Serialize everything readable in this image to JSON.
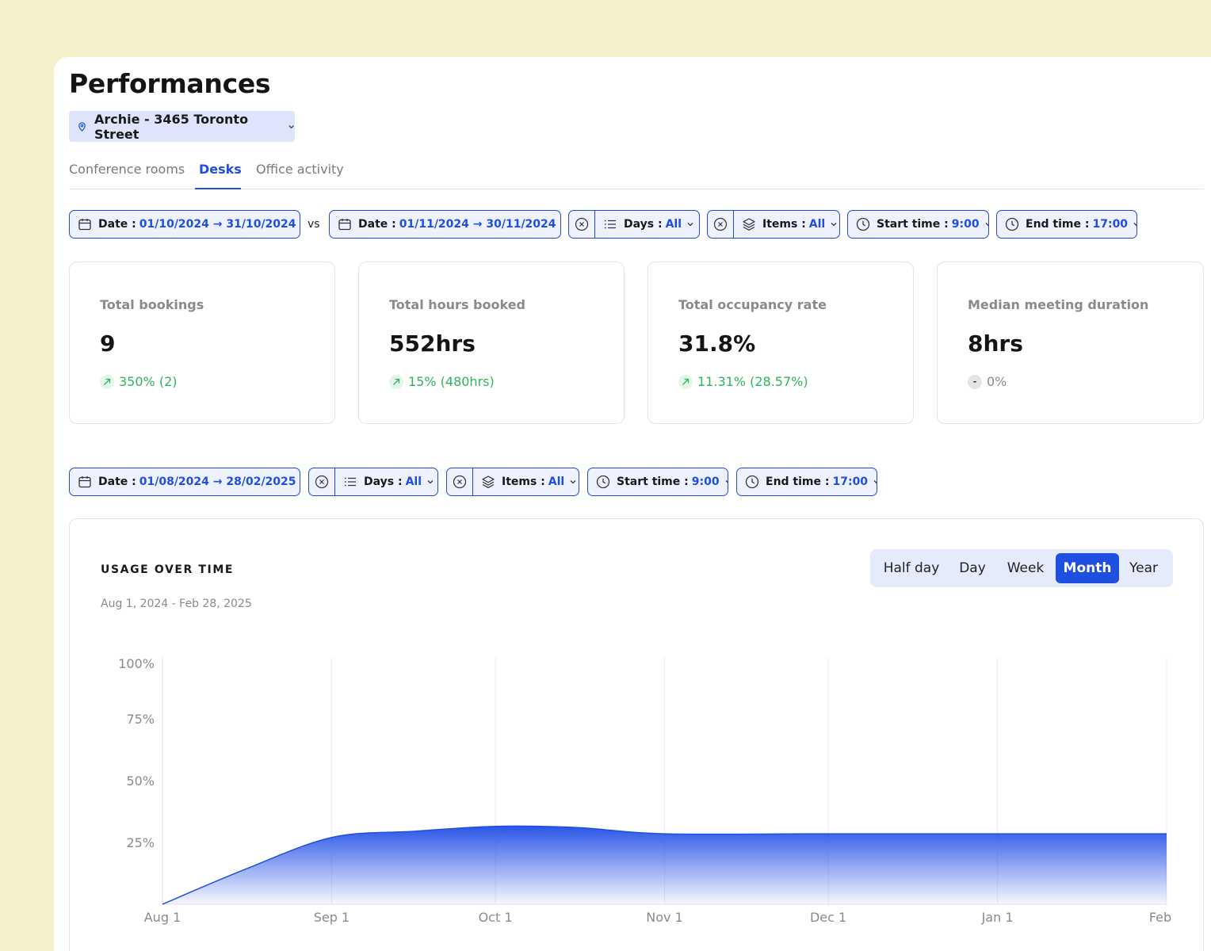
{
  "page": {
    "title": "Performances"
  },
  "location": {
    "label": "Archie - 3465 Toronto Street"
  },
  "tabs": [
    {
      "label": "Conference rooms",
      "active": false
    },
    {
      "label": "Desks",
      "active": true
    },
    {
      "label": "Office activity",
      "active": false
    }
  ],
  "filters_top": {
    "date_a": {
      "label": "Date :",
      "value": "01/10/2024 → 31/10/2024"
    },
    "vs": "vs",
    "date_b": {
      "label": "Date :",
      "value": "01/11/2024 → 30/11/2024"
    },
    "days": {
      "label": "Days :",
      "value": "All"
    },
    "items": {
      "label": "Items :",
      "value": "All"
    },
    "start": {
      "label": "Start time :",
      "value": "9:00"
    },
    "end": {
      "label": "End time :",
      "value": "17:00"
    }
  },
  "stats": [
    {
      "label": "Total bookings",
      "value": "9",
      "delta": "350% (2)",
      "trend": "up"
    },
    {
      "label": "Total hours booked",
      "value": "552hrs",
      "delta": "15% (480hrs)",
      "trend": "up"
    },
    {
      "label": "Total occupancy rate",
      "value": "31.8%",
      "delta": "11.31% (28.57%)",
      "trend": "up"
    },
    {
      "label": "Median meeting duration",
      "value": "8hrs",
      "delta": "0%",
      "trend": "neutral",
      "neutral_symbol": "-"
    }
  ],
  "filters_chart": {
    "date": {
      "label": "Date :",
      "value": "01/08/2024 → 28/02/2025"
    },
    "days": {
      "label": "Days :",
      "value": "All"
    },
    "items": {
      "label": "Items :",
      "value": "All"
    },
    "start": {
      "label": "Start time :",
      "value": "9:00"
    },
    "end": {
      "label": "End time :",
      "value": "17:00"
    }
  },
  "usage": {
    "title": "USAGE OVER TIME",
    "range": "Aug 1, 2024 - Feb 28, 2025",
    "granularity": [
      "Half day",
      "Day",
      "Week",
      "Month",
      "Year"
    ],
    "active_granularity": "Month"
  },
  "colors": {
    "accent": "#1f4fe0",
    "positive": "#2fb45a",
    "background": "#f3f0cc"
  },
  "chart_data": {
    "type": "area",
    "title": "USAGE OVER TIME",
    "xlabel": "",
    "ylabel": "",
    "categories": [
      "Aug 1",
      "Sep 1",
      "Oct 1",
      "Nov 1",
      "Dec 1",
      "Jan 1",
      "Feb"
    ],
    "x": [
      "2024-08-01",
      "2024-08-16",
      "2024-09-01",
      "2024-09-16",
      "2024-10-01",
      "2024-10-16",
      "2024-11-01",
      "2024-12-01",
      "2025-01-01",
      "2025-02-01"
    ],
    "series": [
      {
        "values": [
          0,
          14,
          27,
          29.5,
          31.5,
          31,
          28.5,
          28.5,
          28.5,
          28.5
        ]
      }
    ],
    "ylim": [
      0,
      100
    ],
    "yticks": [
      "25%",
      "50%",
      "75%",
      "100%"
    ],
    "ytick_values": [
      25,
      50,
      75,
      100
    ],
    "grid": true,
    "legend": "none"
  }
}
